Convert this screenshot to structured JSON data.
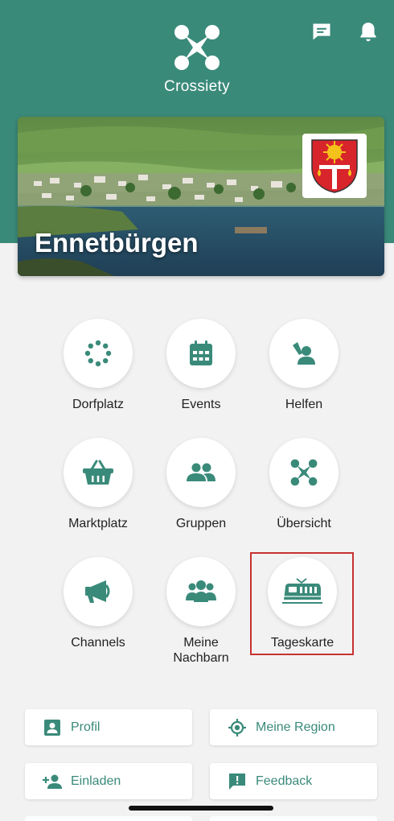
{
  "header": {
    "app_name": "Crossiety",
    "accent_color": "#3a8a7a",
    "icons": [
      "chat-icon",
      "bell-icon"
    ]
  },
  "hero": {
    "village_name": "Ennetbürgen",
    "crest_icon": "ennetbuergen-crest"
  },
  "tiles": [
    {
      "label": "Dorfplatz",
      "icon": "dots-circle-icon"
    },
    {
      "label": "Events",
      "icon": "calendar-icon"
    },
    {
      "label": "Helfen",
      "icon": "helping-hand-icon"
    },
    {
      "label": "Marktplatz",
      "icon": "basket-icon"
    },
    {
      "label": "Gruppen",
      "icon": "users-icon"
    },
    {
      "label": "Übersicht",
      "icon": "crossiety-x-icon"
    },
    {
      "label": "Channels",
      "icon": "megaphone-icon"
    },
    {
      "label": "Meine Nachbarn",
      "icon": "neighbours-icon"
    },
    {
      "label": "Tageskarte",
      "icon": "train-icon"
    }
  ],
  "buttons": [
    {
      "label": "Profil",
      "icon": "profile-icon"
    },
    {
      "label": "Meine Region",
      "icon": "location-target-icon"
    },
    {
      "label": "Einladen",
      "icon": "add-user-icon"
    },
    {
      "label": "Feedback",
      "icon": "feedback-icon"
    }
  ],
  "highlight_color": "#c73232"
}
